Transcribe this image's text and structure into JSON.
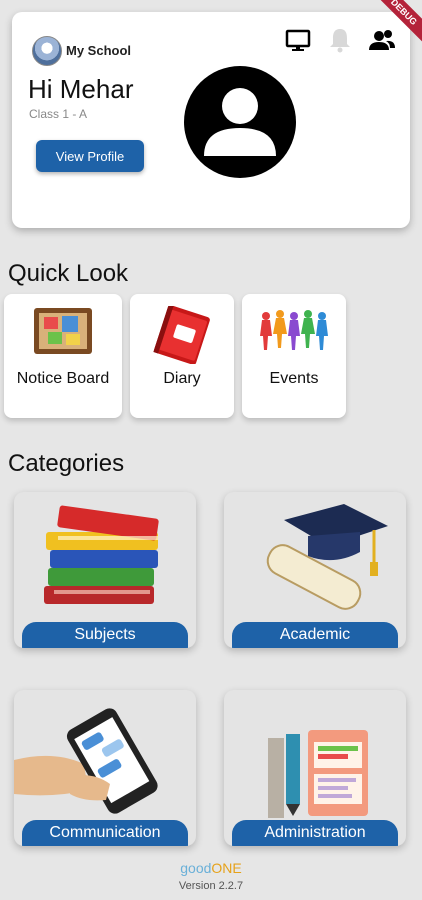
{
  "debug_banner": "DEBUG",
  "header": {
    "school_name": "My School",
    "greeting": "Hi Mehar",
    "class_info": "Class 1 - A",
    "view_profile_label": "View Profile"
  },
  "quick_look": {
    "title": "Quick Look",
    "items": [
      {
        "label": "Notice Board",
        "icon": "notice-board-icon"
      },
      {
        "label": "Diary",
        "icon": "diary-icon"
      },
      {
        "label": "Events",
        "icon": "events-icon"
      }
    ]
  },
  "categories": {
    "title": "Categories",
    "items": [
      {
        "label": "Subjects",
        "icon": "books-icon"
      },
      {
        "label": "Academic",
        "icon": "graduation-icon"
      },
      {
        "label": "Communication",
        "icon": "phone-chat-icon"
      },
      {
        "label": "Administration",
        "icon": "admin-tools-icon"
      }
    ]
  },
  "footer": {
    "brand_good": "good",
    "brand_one": "ONE",
    "version": "Version 2.2.7"
  },
  "colors": {
    "accent": "#1e62a8",
    "background": "#e6e6e6"
  }
}
